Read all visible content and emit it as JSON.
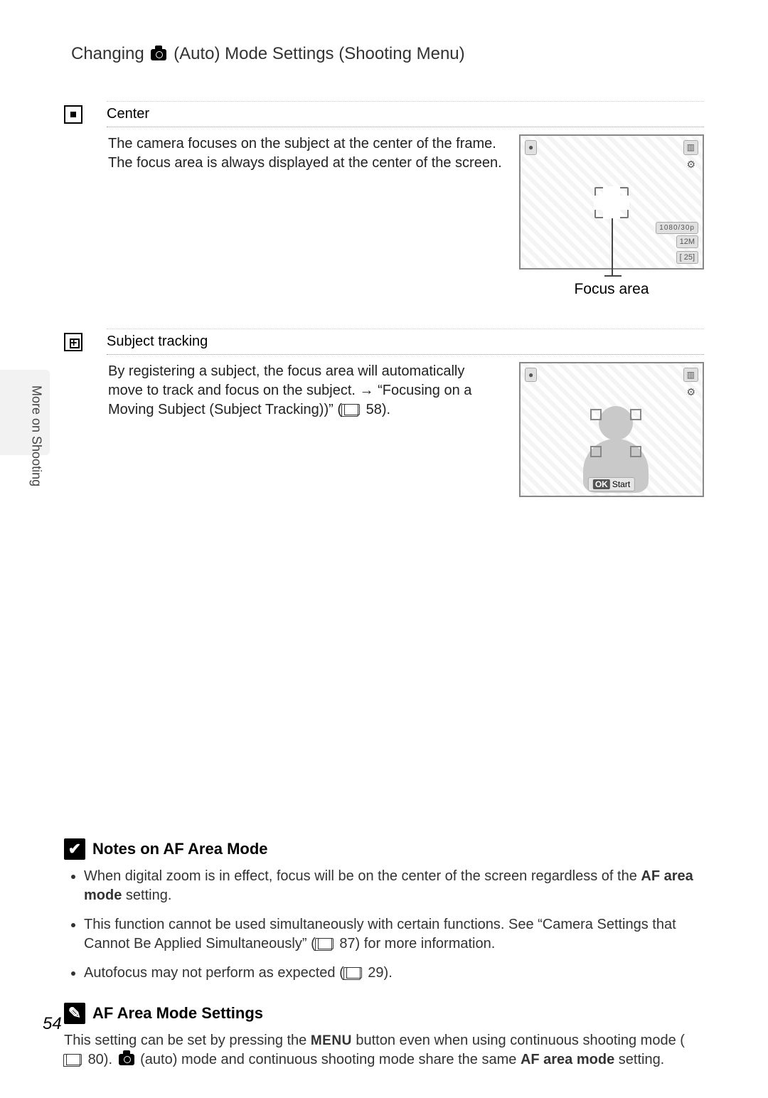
{
  "header": {
    "prefix": "Changing",
    "suffix": "(Auto) Mode Settings (Shooting Menu)"
  },
  "side_tab": "More on Shooting",
  "entries": {
    "center": {
      "title": "Center",
      "body_line1": "The camera focuses on the subject at the center of the frame.",
      "body_line2": "The focus area is always displayed at the center of the screen.",
      "screen": {
        "badge_tl": "●",
        "badge_tr": "▥",
        "badge_r2": "⚙",
        "br1": "1080/30p",
        "br2": "12M",
        "br3": "[   25]"
      },
      "caption": "Focus area"
    },
    "tracking": {
      "title": "Subject tracking",
      "body_p1": "By registering a subject, the focus area will automatically move to track and focus on the subject. → “Focusing on a Moving Subject (Subject Tracking))” (",
      "body_p1_ref": "58).",
      "screen": {
        "badge_tl": "●",
        "badge_tr": "▥",
        "badge_r2": "⚙",
        "ok_label": "OK",
        "start_label": "Start"
      }
    }
  },
  "notes": {
    "title": "Notes on AF Area Mode",
    "items": {
      "i1a": "When digital zoom is in effect, focus will be on the center of the screen regardless of the ",
      "i1b": "AF area mode",
      "i1c": " setting.",
      "i2a": "This function cannot be used simultaneously with certain functions. See “Camera Settings that Cannot Be Applied Simultaneously” (",
      "i2b": "87) for more information.",
      "i3a": "Autofocus may not perform as expected (",
      "i3b": "29)."
    }
  },
  "tip": {
    "title": "AF Area Mode Settings",
    "t1": "This setting can be set by pressing the ",
    "menu": "MENU",
    "t2": " button even when using continuous shooting mode (",
    "t2ref": "80). ",
    "t3": " (auto) mode and continuous shooting mode share the same ",
    "bold": "AF area mode",
    "t4": " setting."
  },
  "page_number": "54"
}
